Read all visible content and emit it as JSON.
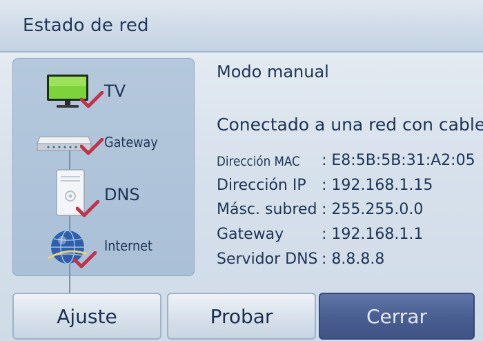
{
  "window": {
    "title": "Estado de red"
  },
  "status_panel": {
    "nodes": [
      {
        "label": "TV",
        "icon": "tv-icon",
        "status": "ok"
      },
      {
        "label": "Gateway",
        "icon": "router-icon",
        "status": "ok"
      },
      {
        "label": "DNS",
        "icon": "server-icon",
        "status": "ok"
      },
      {
        "label": "Internet",
        "icon": "globe-icon",
        "status": "ok"
      }
    ],
    "check_color": "#c0334a"
  },
  "info": {
    "mode": "Modo manual",
    "connection_status": "Conectado a una red con cable.",
    "rows": [
      {
        "label": "Dirección MAC",
        "value": ": E8:5B:5B:31:A2:05"
      },
      {
        "label": "Dirección IP",
        "value": ": 192.168.1.15"
      },
      {
        "label": "Másc. subred",
        "value": ": 255.255.0.0"
      },
      {
        "label": "Gateway",
        "value": ": 192.168.1.1"
      },
      {
        "label": "Servidor DNS",
        "value": ": 8.8.8.8"
      }
    ]
  },
  "buttons": {
    "settings": "Ajuste",
    "test": "Probar",
    "close": "Cerrar"
  },
  "colors": {
    "accent": "#4a5f92",
    "text": "#1e3454"
  }
}
